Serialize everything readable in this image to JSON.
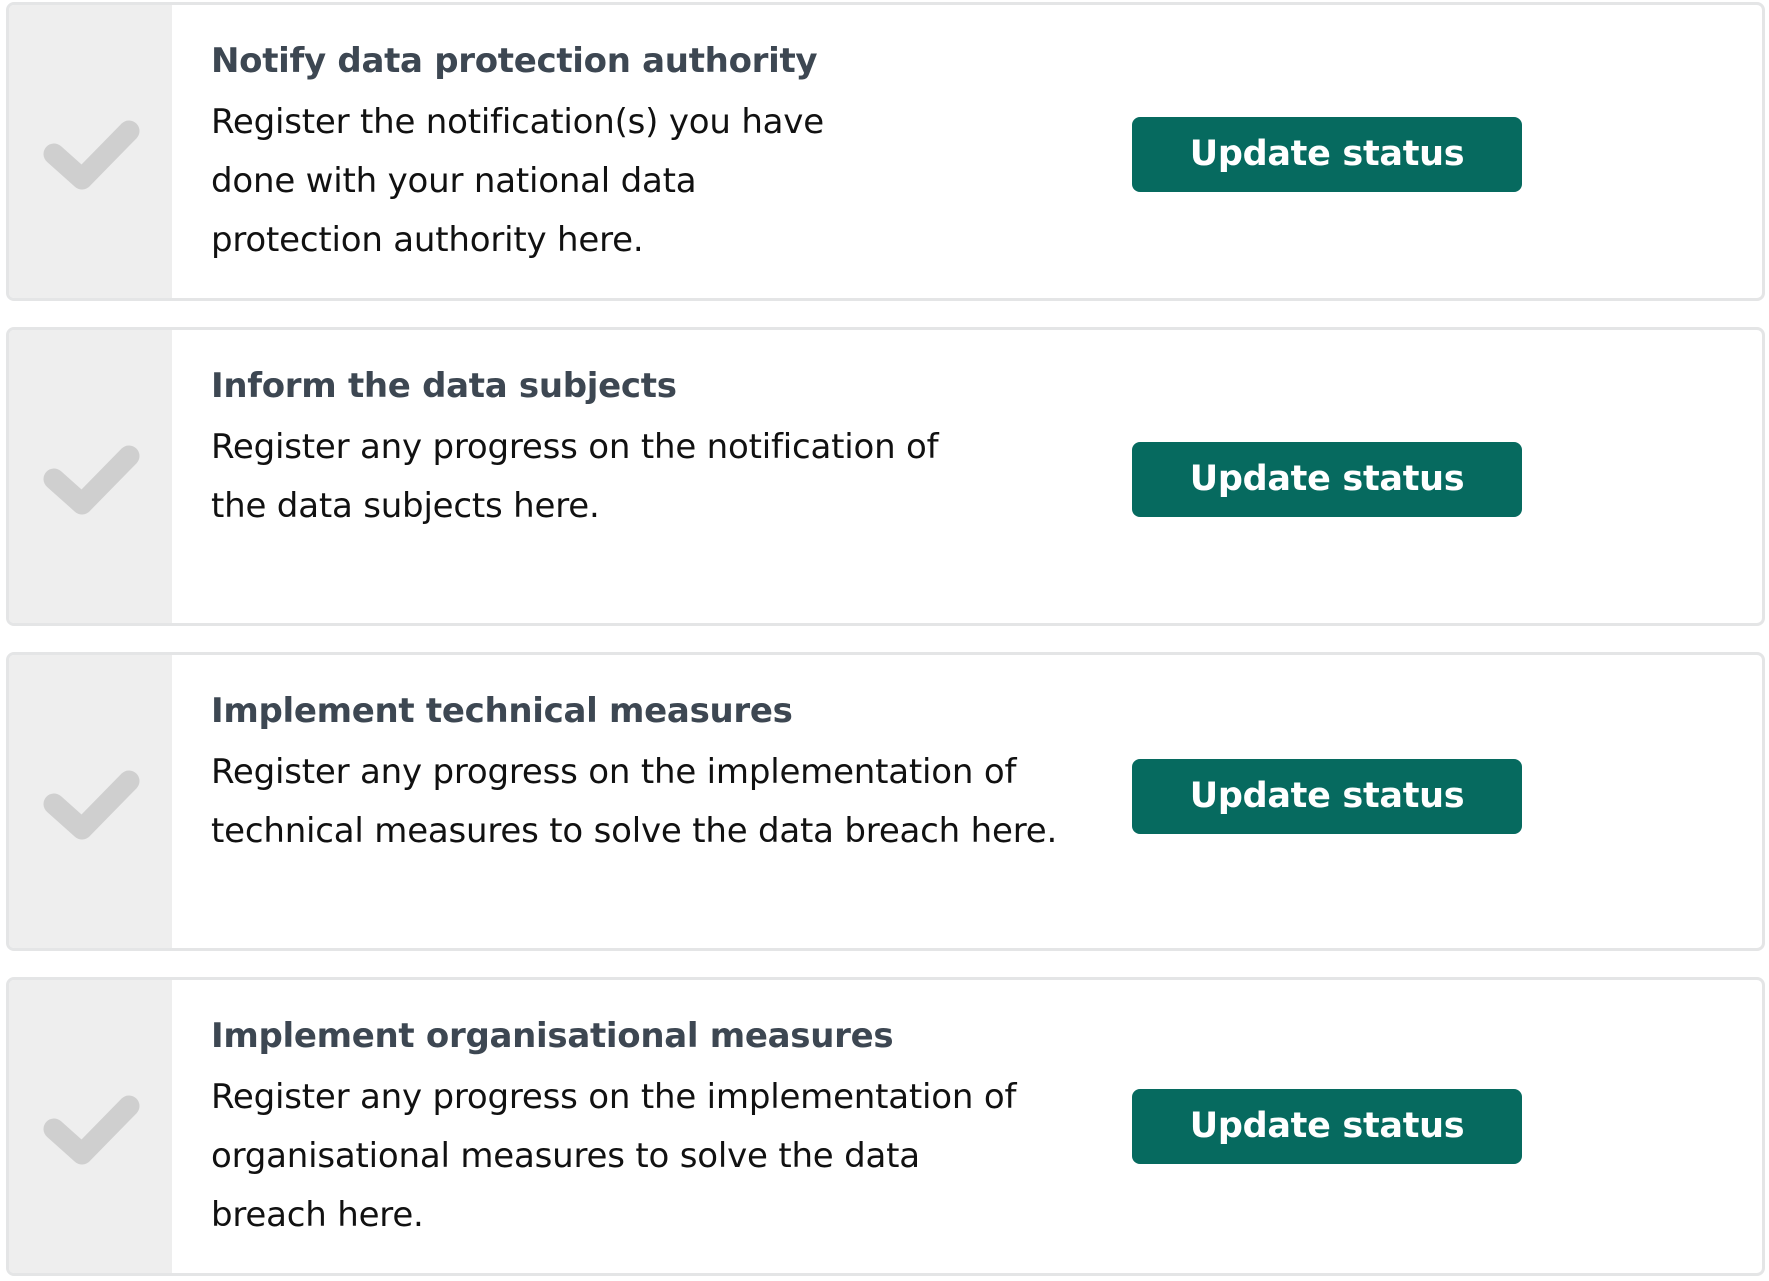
{
  "tasks": [
    {
      "title": "Notify data protection authority",
      "description": "Register the notification(s) you have done with your national data protection authority here.",
      "button_label": "Update status",
      "checked": false
    },
    {
      "title": "Inform the data subjects",
      "description": "Register any progress on the notification of the data subjects here.",
      "button_label": "Update status",
      "checked": false
    },
    {
      "title": "Implement technical measures",
      "description": "Register any progress on the implementation of technical measures to solve the data breach here.",
      "button_label": "Update status",
      "checked": false
    },
    {
      "title": "Implement organisational measures",
      "description": "Register any progress on the implementation of organisational measures to solve the data breach here.",
      "button_label": "Update status",
      "checked": false
    }
  ],
  "colors": {
    "button": "#066a5f",
    "title": "#3d4752",
    "check_inactive": "#cfcfcf",
    "check_column": "#eeeeee",
    "card_border": "#e4e5e6"
  },
  "icons": {
    "check": "check-icon"
  }
}
